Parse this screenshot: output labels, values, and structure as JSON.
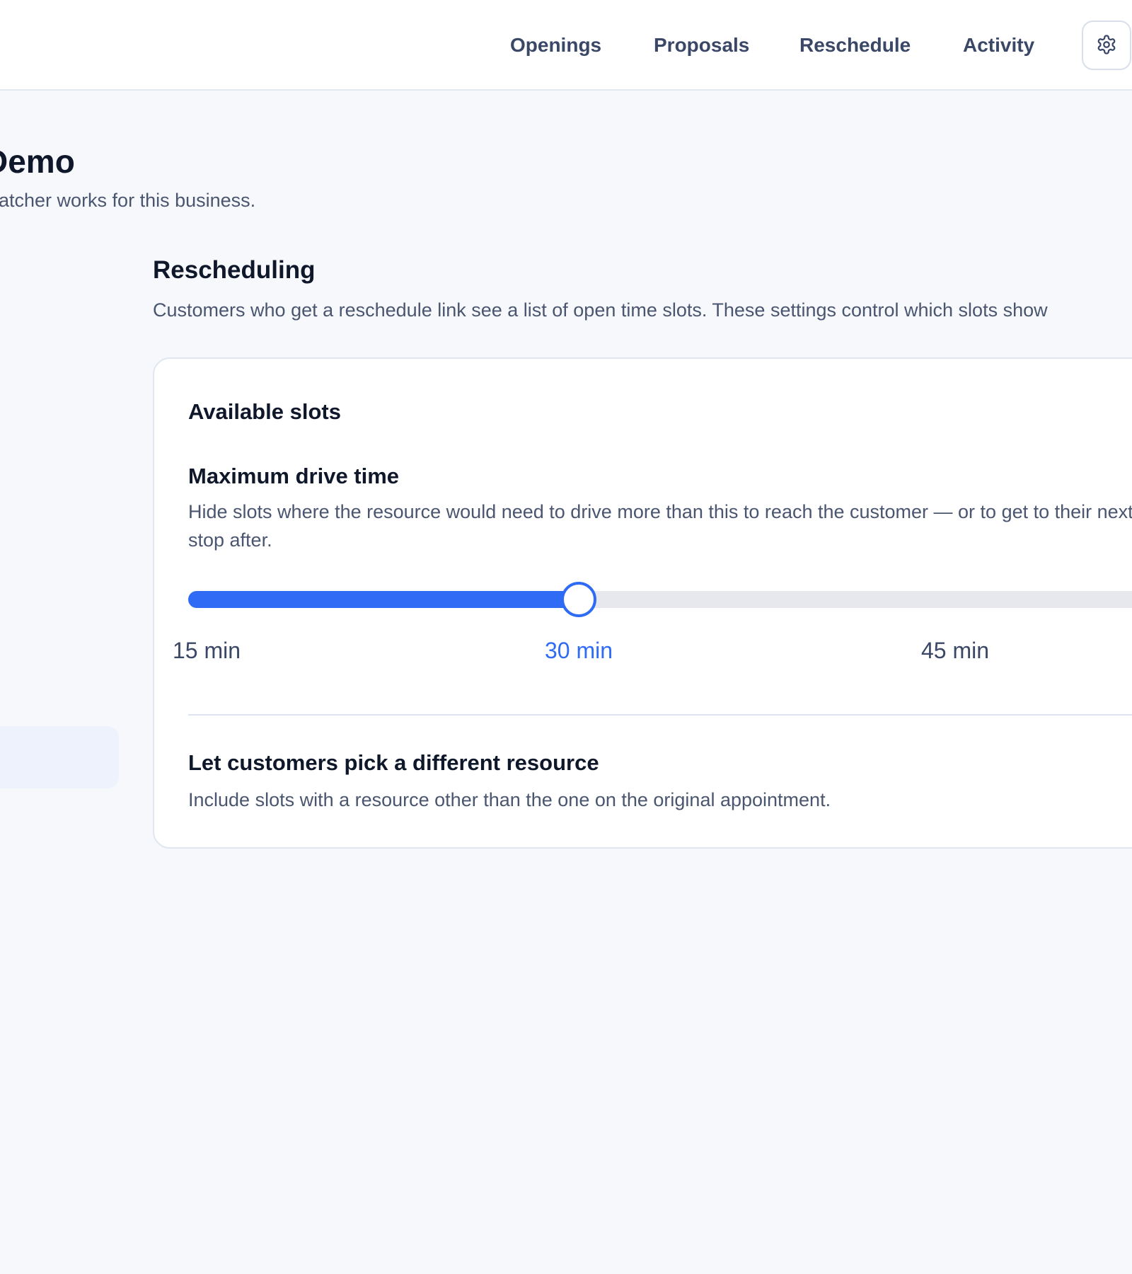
{
  "nav": {
    "items": [
      "Openings",
      "Proposals",
      "Reschedule",
      "Activity"
    ],
    "settings_icon": "gear-icon"
  },
  "page": {
    "title": "Demo",
    "subtitle": "Patcher works for this business."
  },
  "section": {
    "title": "Rescheduling",
    "description": "Customers who get a reschedule link see a list of open time slots. These settings control which slots show"
  },
  "card": {
    "title": "Available slots",
    "drive_time": {
      "title": "Maximum drive time",
      "description": "Hide slots where the resource would need to drive more than this to reach the customer — or to get to their next stop after.",
      "slider": {
        "selected_value": "30 min",
        "ticks": [
          "15 min",
          "30 min",
          "45 min"
        ]
      }
    },
    "resource": {
      "title": "Let customers pick a different resource",
      "description": "Include slots with a resource other than the one on the original appointment."
    }
  },
  "colors": {
    "accent": "#2f6bf4",
    "track": "#e6e8ee",
    "background": "#f7f8fc",
    "text_primary": "#0f172a",
    "text_secondary": "#4a5670"
  }
}
